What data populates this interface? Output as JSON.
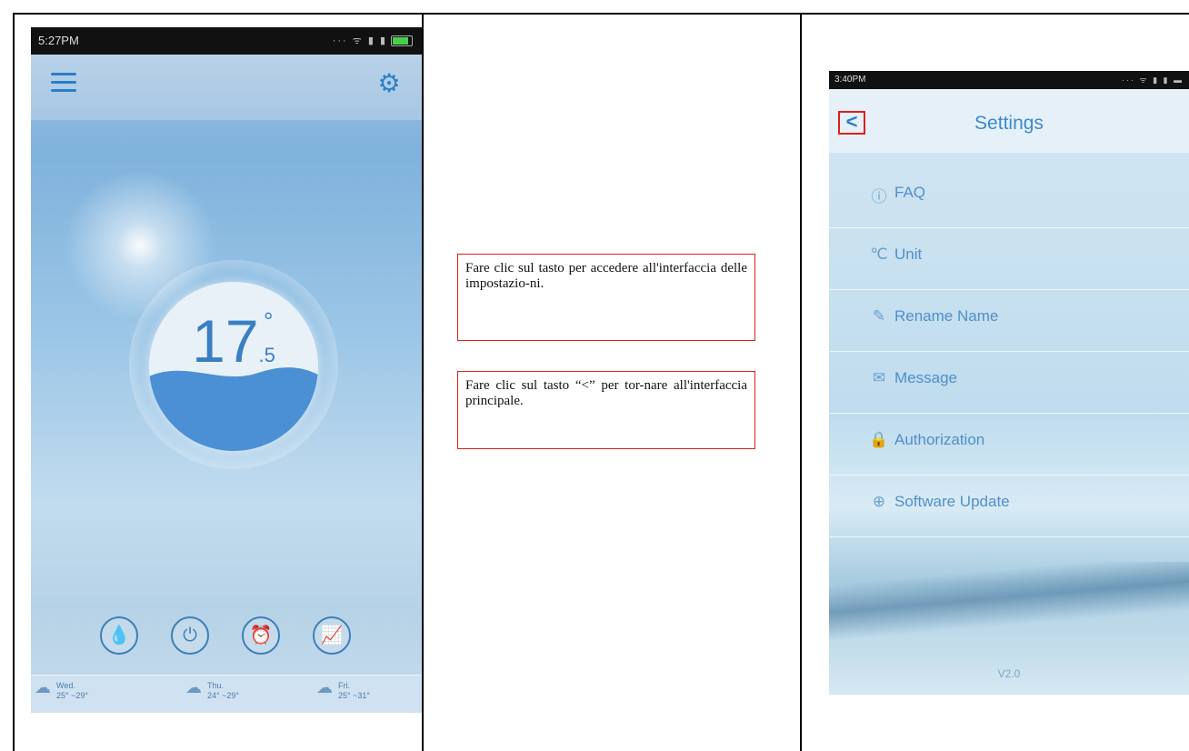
{
  "left_phone": {
    "status_time": "5:27PM",
    "temperature": {
      "integer": "17",
      "decimal": ".5",
      "degree": "°"
    },
    "dock_buttons": [
      {
        "name": "humidity",
        "glyph": "💧"
      },
      {
        "name": "power",
        "glyph": "⏻"
      },
      {
        "name": "alarm",
        "glyph": "⏰"
      },
      {
        "name": "chart",
        "glyph": "📈"
      }
    ],
    "weather": [
      {
        "day": "Wed.",
        "range": "25° ~29°"
      },
      {
        "day": "Thu.",
        "range": "24° ~29°"
      },
      {
        "day": "Fri.",
        "range": "25° ~31°"
      }
    ]
  },
  "notes": {
    "note1": "Fare clic sul tasto per accedere all'interfaccia delle impostazio-ni.",
    "note2": "Fare clic sul tasto “<” per tor-nare all'interfaccia principale."
  },
  "right_phone": {
    "status_time": "3:40PM",
    "back_label": "<",
    "title": "Settings",
    "items": [
      {
        "icon": "ⓘ",
        "label": "FAQ"
      },
      {
        "icon": "℃",
        "label": "Unit"
      },
      {
        "icon": "✎",
        "label": "Rename Name"
      },
      {
        "icon": "✉",
        "label": "Message"
      },
      {
        "icon": "🔒",
        "label": "Authorization"
      },
      {
        "icon": "⊕",
        "label": "Software Update"
      }
    ],
    "version": "V2.0"
  }
}
